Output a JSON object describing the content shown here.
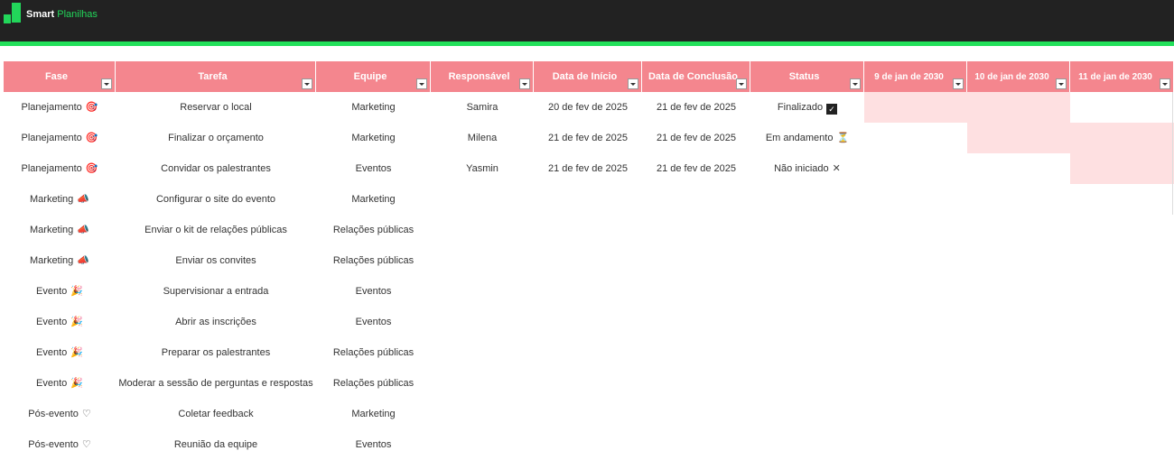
{
  "brand": {
    "name_bold": "Smart",
    "name_light": "Planilhas"
  },
  "colors": {
    "topbar": "#222222",
    "accent_green": "#22e05a",
    "header_pink": "#f4868e",
    "gantt_pink": "#fee0e1"
  },
  "table": {
    "headers": {
      "fase": "Fase",
      "tarefa": "Tarefa",
      "equipe": "Equipe",
      "responsavel": "Responsável",
      "inicio": "Data de Início",
      "conclusao": "Data de Conclusão",
      "status": "Status",
      "d1": "9 de jan de 2030",
      "d2": "10 de jan de 2030",
      "d3": "11 de jan de 2030"
    },
    "rows": [
      {
        "fase": "Planejamento",
        "fase_icon": "🎯",
        "tarefa": "Reservar o local",
        "equipe": "Marketing",
        "responsavel": "Samira",
        "inicio": "20 de fev de 2025",
        "conclusao": "21 de fev de 2025",
        "status": "Finalizado",
        "status_icon": "✓",
        "gantt": [
          true,
          true,
          false
        ]
      },
      {
        "fase": "Planejamento",
        "fase_icon": "🎯",
        "tarefa": "Finalizar o orçamento",
        "equipe": "Marketing",
        "responsavel": "Milena",
        "inicio": "21 de fev de 2025",
        "conclusao": "21 de fev de 2025",
        "status": "Em andamento",
        "status_icon": "⏳",
        "gantt": [
          false,
          true,
          true
        ]
      },
      {
        "fase": "Planejamento",
        "fase_icon": "🎯",
        "tarefa": "Convidar os palestrantes",
        "equipe": "Eventos",
        "responsavel": "Yasmin",
        "inicio": "21 de fev de 2025",
        "conclusao": "21 de fev de 2025",
        "status": "Não iniciado",
        "status_icon": "✕",
        "gantt": [
          false,
          false,
          true
        ]
      },
      {
        "fase": "Marketing",
        "fase_icon": "📣",
        "tarefa": "Configurar o site do evento",
        "equipe": "Marketing",
        "responsavel": "",
        "inicio": "",
        "conclusao": "",
        "status": "",
        "status_icon": "",
        "gantt": [
          false,
          false,
          false
        ]
      },
      {
        "fase": "Marketing",
        "fase_icon": "📣",
        "tarefa": "Enviar o kit de relações públicas",
        "equipe": "Relações públicas",
        "responsavel": "",
        "inicio": "",
        "conclusao": "",
        "status": "",
        "status_icon": "",
        "gantt": [
          false,
          false,
          false
        ]
      },
      {
        "fase": "Marketing",
        "fase_icon": "📣",
        "tarefa": "Enviar os convites",
        "equipe": "Relações públicas",
        "responsavel": "",
        "inicio": "",
        "conclusao": "",
        "status": "",
        "status_icon": "",
        "gantt": [
          false,
          false,
          false
        ]
      },
      {
        "fase": "Evento",
        "fase_icon": "🎉",
        "tarefa": "Supervisionar a entrada",
        "equipe": "Eventos",
        "responsavel": "",
        "inicio": "",
        "conclusao": "",
        "status": "",
        "status_icon": "",
        "gantt": [
          false,
          false,
          false
        ]
      },
      {
        "fase": "Evento",
        "fase_icon": "🎉",
        "tarefa": "Abrir as inscrições",
        "equipe": "Eventos",
        "responsavel": "",
        "inicio": "",
        "conclusao": "",
        "status": "",
        "status_icon": "",
        "gantt": [
          false,
          false,
          false
        ]
      },
      {
        "fase": "Evento",
        "fase_icon": "🎉",
        "tarefa": "Preparar os palestrantes",
        "equipe": "Relações públicas",
        "responsavel": "",
        "inicio": "",
        "conclusao": "",
        "status": "",
        "status_icon": "",
        "gantt": [
          false,
          false,
          false
        ]
      },
      {
        "fase": "Evento",
        "fase_icon": "🎉",
        "tarefa": "Moderar a sessão de perguntas e respostas",
        "equipe": "Relações públicas",
        "responsavel": "",
        "inicio": "",
        "conclusao": "",
        "status": "",
        "status_icon": "",
        "gantt": [
          false,
          false,
          false
        ]
      },
      {
        "fase": "Pós-evento",
        "fase_icon": "♡",
        "tarefa": "Coletar feedback",
        "equipe": "Marketing",
        "responsavel": "",
        "inicio": "",
        "conclusao": "",
        "status": "",
        "status_icon": "",
        "gantt": [
          false,
          false,
          false
        ]
      },
      {
        "fase": "Pós-evento",
        "fase_icon": "♡",
        "tarefa": "Reunião da equipe",
        "equipe": "Eventos",
        "responsavel": "",
        "inicio": "",
        "conclusao": "",
        "status": "",
        "status_icon": "",
        "gantt": [
          false,
          false,
          false
        ]
      }
    ]
  }
}
